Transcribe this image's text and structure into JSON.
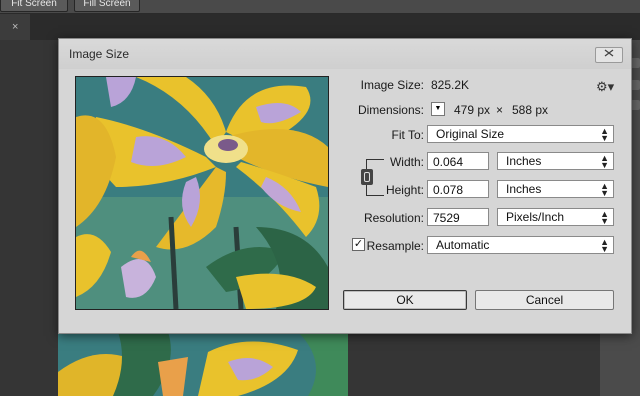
{
  "toolbar": {
    "fit_screen": "Fit Screen",
    "fill_screen": "Fill Screen"
  },
  "tab": {
    "close": "×"
  },
  "dialog": {
    "title": "Image Size",
    "close_icon": "close-icon",
    "image_size_label": "Image Size:",
    "image_size_value": "825.2K",
    "settings_icon": "gear-icon",
    "dimensions_label": "Dimensions:",
    "dimensions_width": "479 px",
    "dimensions_times": "×",
    "dimensions_height": "588 px",
    "fit_to_label": "Fit To:",
    "fit_to_value": "Original Size",
    "width_label": "Width:",
    "width_value": "0.064",
    "width_unit": "Inches",
    "height_label": "Height:",
    "height_value": "0.078",
    "height_unit": "Inches",
    "resolution_label": "Resolution:",
    "resolution_value": "7529",
    "resolution_unit": "Pixels/Inch",
    "resample_label": "Resample:",
    "resample_checked": true,
    "resample_value": "Automatic",
    "ok_label": "OK",
    "cancel_label": "Cancel"
  },
  "colors": {
    "dialog_bg": "#d6d6d6",
    "app_bg": "#353535",
    "flower_yellow": "#e9c22c",
    "flower_lilac": "#b9a3d8",
    "leaf_green": "#2f6b4a",
    "sky_teal": "#3a7d80"
  }
}
